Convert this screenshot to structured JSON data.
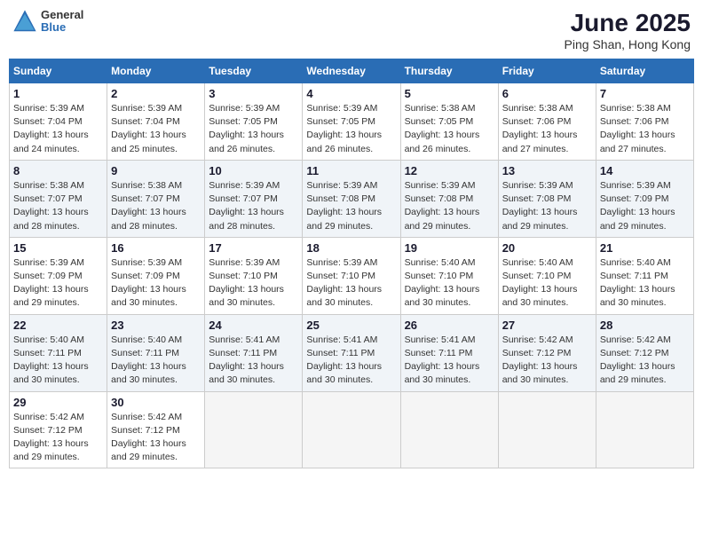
{
  "header": {
    "logo_line1": "General",
    "logo_line2": "Blue",
    "title": "June 2025",
    "subtitle": "Ping Shan, Hong Kong"
  },
  "days_of_week": [
    "Sunday",
    "Monday",
    "Tuesday",
    "Wednesday",
    "Thursday",
    "Friday",
    "Saturday"
  ],
  "weeks": [
    {
      "shade": "white",
      "days": [
        {
          "num": "1",
          "info": "Sunrise: 5:39 AM\nSunset: 7:04 PM\nDaylight: 13 hours\nand 24 minutes."
        },
        {
          "num": "2",
          "info": "Sunrise: 5:39 AM\nSunset: 7:04 PM\nDaylight: 13 hours\nand 25 minutes."
        },
        {
          "num": "3",
          "info": "Sunrise: 5:39 AM\nSunset: 7:05 PM\nDaylight: 13 hours\nand 26 minutes."
        },
        {
          "num": "4",
          "info": "Sunrise: 5:39 AM\nSunset: 7:05 PM\nDaylight: 13 hours\nand 26 minutes."
        },
        {
          "num": "5",
          "info": "Sunrise: 5:38 AM\nSunset: 7:05 PM\nDaylight: 13 hours\nand 26 minutes."
        },
        {
          "num": "6",
          "info": "Sunrise: 5:38 AM\nSunset: 7:06 PM\nDaylight: 13 hours\nand 27 minutes."
        },
        {
          "num": "7",
          "info": "Sunrise: 5:38 AM\nSunset: 7:06 PM\nDaylight: 13 hours\nand 27 minutes."
        }
      ]
    },
    {
      "shade": "shaded",
      "days": [
        {
          "num": "8",
          "info": "Sunrise: 5:38 AM\nSunset: 7:07 PM\nDaylight: 13 hours\nand 28 minutes."
        },
        {
          "num": "9",
          "info": "Sunrise: 5:38 AM\nSunset: 7:07 PM\nDaylight: 13 hours\nand 28 minutes."
        },
        {
          "num": "10",
          "info": "Sunrise: 5:39 AM\nSunset: 7:07 PM\nDaylight: 13 hours\nand 28 minutes."
        },
        {
          "num": "11",
          "info": "Sunrise: 5:39 AM\nSunset: 7:08 PM\nDaylight: 13 hours\nand 29 minutes."
        },
        {
          "num": "12",
          "info": "Sunrise: 5:39 AM\nSunset: 7:08 PM\nDaylight: 13 hours\nand 29 minutes."
        },
        {
          "num": "13",
          "info": "Sunrise: 5:39 AM\nSunset: 7:08 PM\nDaylight: 13 hours\nand 29 minutes."
        },
        {
          "num": "14",
          "info": "Sunrise: 5:39 AM\nSunset: 7:09 PM\nDaylight: 13 hours\nand 29 minutes."
        }
      ]
    },
    {
      "shade": "white",
      "days": [
        {
          "num": "15",
          "info": "Sunrise: 5:39 AM\nSunset: 7:09 PM\nDaylight: 13 hours\nand 29 minutes."
        },
        {
          "num": "16",
          "info": "Sunrise: 5:39 AM\nSunset: 7:09 PM\nDaylight: 13 hours\nand 30 minutes."
        },
        {
          "num": "17",
          "info": "Sunrise: 5:39 AM\nSunset: 7:10 PM\nDaylight: 13 hours\nand 30 minutes."
        },
        {
          "num": "18",
          "info": "Sunrise: 5:39 AM\nSunset: 7:10 PM\nDaylight: 13 hours\nand 30 minutes."
        },
        {
          "num": "19",
          "info": "Sunrise: 5:40 AM\nSunset: 7:10 PM\nDaylight: 13 hours\nand 30 minutes."
        },
        {
          "num": "20",
          "info": "Sunrise: 5:40 AM\nSunset: 7:10 PM\nDaylight: 13 hours\nand 30 minutes."
        },
        {
          "num": "21",
          "info": "Sunrise: 5:40 AM\nSunset: 7:11 PM\nDaylight: 13 hours\nand 30 minutes."
        }
      ]
    },
    {
      "shade": "shaded",
      "days": [
        {
          "num": "22",
          "info": "Sunrise: 5:40 AM\nSunset: 7:11 PM\nDaylight: 13 hours\nand 30 minutes."
        },
        {
          "num": "23",
          "info": "Sunrise: 5:40 AM\nSunset: 7:11 PM\nDaylight: 13 hours\nand 30 minutes."
        },
        {
          "num": "24",
          "info": "Sunrise: 5:41 AM\nSunset: 7:11 PM\nDaylight: 13 hours\nand 30 minutes."
        },
        {
          "num": "25",
          "info": "Sunrise: 5:41 AM\nSunset: 7:11 PM\nDaylight: 13 hours\nand 30 minutes."
        },
        {
          "num": "26",
          "info": "Sunrise: 5:41 AM\nSunset: 7:11 PM\nDaylight: 13 hours\nand 30 minutes."
        },
        {
          "num": "27",
          "info": "Sunrise: 5:42 AM\nSunset: 7:12 PM\nDaylight: 13 hours\nand 30 minutes."
        },
        {
          "num": "28",
          "info": "Sunrise: 5:42 AM\nSunset: 7:12 PM\nDaylight: 13 hours\nand 29 minutes."
        }
      ]
    },
    {
      "shade": "white",
      "days": [
        {
          "num": "29",
          "info": "Sunrise: 5:42 AM\nSunset: 7:12 PM\nDaylight: 13 hours\nand 29 minutes."
        },
        {
          "num": "30",
          "info": "Sunrise: 5:42 AM\nSunset: 7:12 PM\nDaylight: 13 hours\nand 29 minutes."
        },
        {
          "num": "",
          "info": ""
        },
        {
          "num": "",
          "info": ""
        },
        {
          "num": "",
          "info": ""
        },
        {
          "num": "",
          "info": ""
        },
        {
          "num": "",
          "info": ""
        }
      ]
    }
  ]
}
